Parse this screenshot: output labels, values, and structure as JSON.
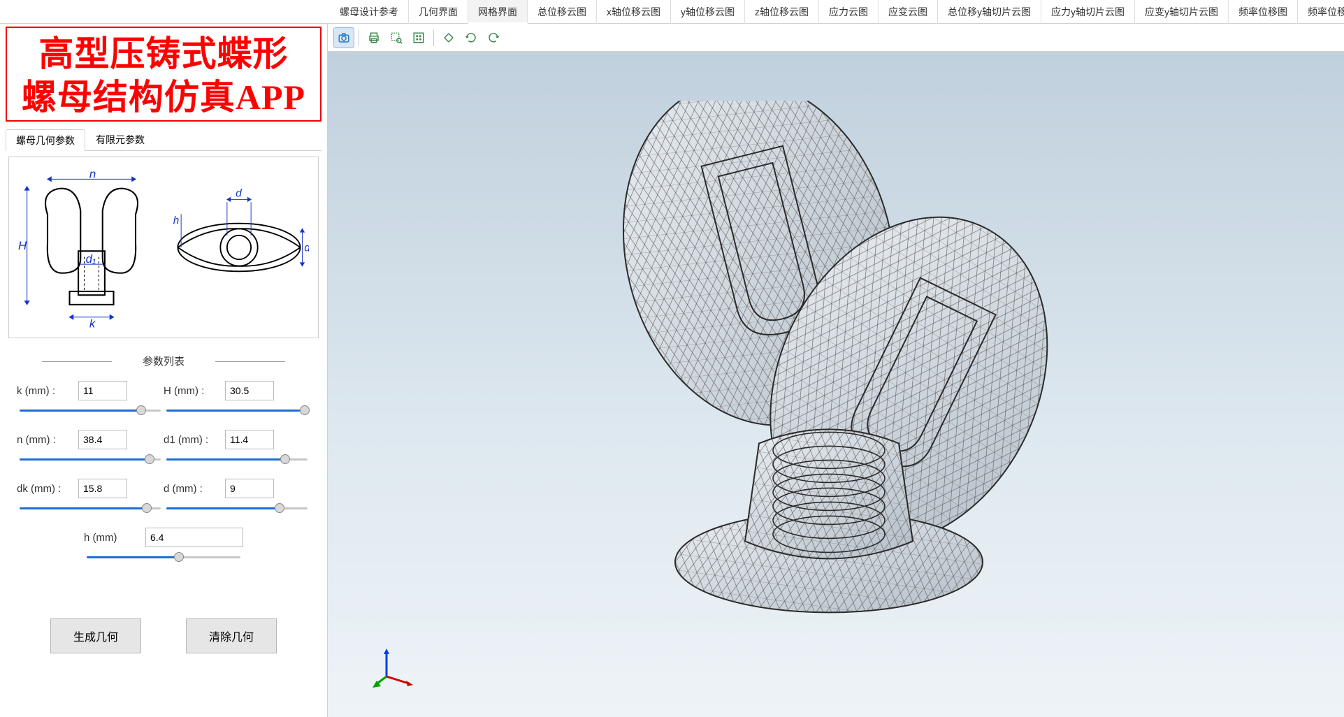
{
  "title": {
    "line1": "高型压铸式蝶形",
    "line2": "螺母结构仿真APP"
  },
  "top_tabs": [
    "螺母设计参考",
    "几何界面",
    "网格界面",
    "总位移云图",
    "x轴位移云图",
    "y轴位移云图",
    "z轴位移云图",
    "应力云图",
    "应变云图",
    "总位移y轴切片云图",
    "应力y轴切片云图",
    "应变y轴切片云图",
    "频率位移图",
    "频率位移切片图"
  ],
  "top_tabs_active": 2,
  "param_tabs": [
    "螺母几何参数",
    "有限元参数"
  ],
  "param_tabs_active": 0,
  "param_list_header": "参数列表",
  "params": {
    "k": {
      "label": "k (mm) :",
      "value": "11",
      "pct": 86
    },
    "H": {
      "label": "H (mm) :",
      "value": "30.5",
      "pct": 98
    },
    "n": {
      "label": "n (mm) :",
      "value": "38.4",
      "pct": 92
    },
    "d1": {
      "label": "d1 (mm) :",
      "value": "11.4",
      "pct": 84
    },
    "dk": {
      "label": "dk (mm) :",
      "value": "15.8",
      "pct": 90
    },
    "d": {
      "label": "d (mm) :",
      "value": "9",
      "pct": 80
    },
    "h": {
      "label": "h (mm)",
      "value": "6.4",
      "pct": 60
    }
  },
  "buttons": {
    "generate": "生成几何",
    "clear": "清除几何"
  },
  "toolbar_icons": [
    "camera",
    "print",
    "zoom-box",
    "zoom-extents",
    "reset-view",
    "rotate-ccw",
    "rotate-cw"
  ],
  "diagram_labels": {
    "n": "n",
    "H": "H",
    "d1": "d₁",
    "h": "h",
    "k": "k",
    "d": "d",
    "dk": "dₖ"
  }
}
